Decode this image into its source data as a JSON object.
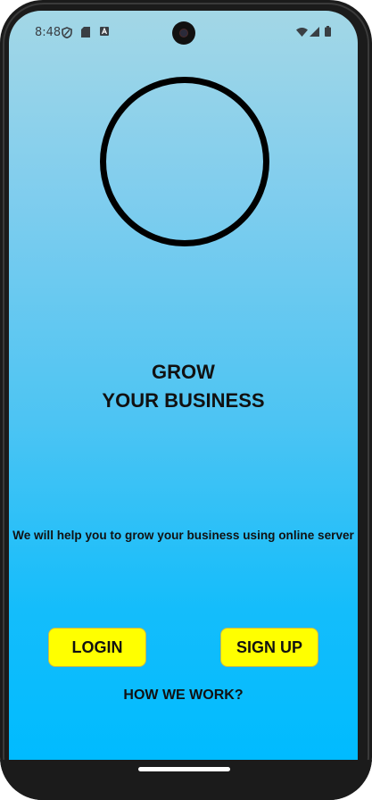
{
  "status_bar": {
    "time": "8:48",
    "left_icons": [
      "vpn-shield-icon",
      "sd-card-icon",
      "notification-a-icon"
    ],
    "right_icons": [
      "wifi-icon",
      "cell-signal-icon",
      "battery-icon"
    ]
  },
  "hero": {
    "logo": "empty-circle-logo",
    "headline_line1": "GROW",
    "headline_line2": "YOUR BUSINESS"
  },
  "tagline": "We will help you to grow your business using online server",
  "actions": {
    "login_label": "LOGIN",
    "signup_label": "SIGN UP",
    "how_label": "HOW WE WORK?"
  },
  "colors": {
    "gradient_top": "#a3d7e6",
    "gradient_bottom": "#00bbff",
    "button_bg": "#ffff00",
    "text": "#111111"
  }
}
